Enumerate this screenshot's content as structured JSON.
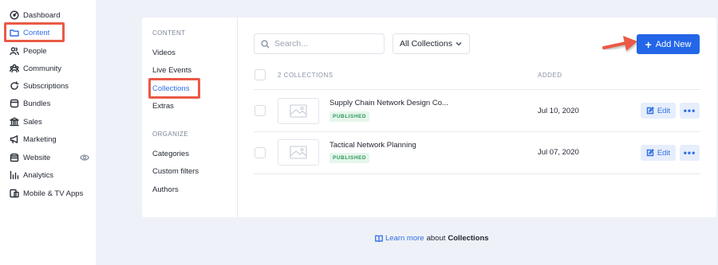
{
  "sidebar": {
    "items": [
      {
        "label": "Dashboard",
        "icon": "dashboard-icon"
      },
      {
        "label": "Content",
        "icon": "folder-icon",
        "active": true
      },
      {
        "label": "People",
        "icon": "people-icon"
      },
      {
        "label": "Community",
        "icon": "community-icon"
      },
      {
        "label": "Subscriptions",
        "icon": "subscriptions-icon"
      },
      {
        "label": "Bundles",
        "icon": "bundles-icon"
      },
      {
        "label": "Sales",
        "icon": "sales-icon"
      },
      {
        "label": "Marketing",
        "icon": "megaphone-icon"
      },
      {
        "label": "Website",
        "icon": "website-icon"
      },
      {
        "label": "Analytics",
        "icon": "analytics-icon"
      },
      {
        "label": "Mobile & TV Apps",
        "icon": "mobile-tv-icon"
      }
    ]
  },
  "subnav": {
    "content_heading": "CONTENT",
    "content_items": [
      "Videos",
      "Live Events",
      "Collections",
      "Extras"
    ],
    "active_item": "Collections",
    "organize_heading": "ORGANIZE",
    "organize_items": [
      "Categories",
      "Custom filters",
      "Authors"
    ]
  },
  "toolbar": {
    "search_placeholder": "Search...",
    "filter_value": "All Collections",
    "add_label": "Add New"
  },
  "table": {
    "count_header": "2 COLLECTIONS",
    "added_header": "ADDED",
    "rows": [
      {
        "title": "Supply Chain Network Design Co...",
        "status": "PUBLISHED",
        "added": "Jul 10, 2020",
        "edit_label": "Edit"
      },
      {
        "title": "Tactical Network Planning",
        "status": "PUBLISHED",
        "added": "Jul 07, 2020",
        "edit_label": "Edit"
      }
    ]
  },
  "footer": {
    "link_text": "Learn more",
    "middle_text": "about",
    "subject": "Collections"
  },
  "colors": {
    "accent": "#2466e8",
    "highlight": "#ea5a47",
    "published_green": "#2d9a5a",
    "background": "#eef1f7"
  }
}
